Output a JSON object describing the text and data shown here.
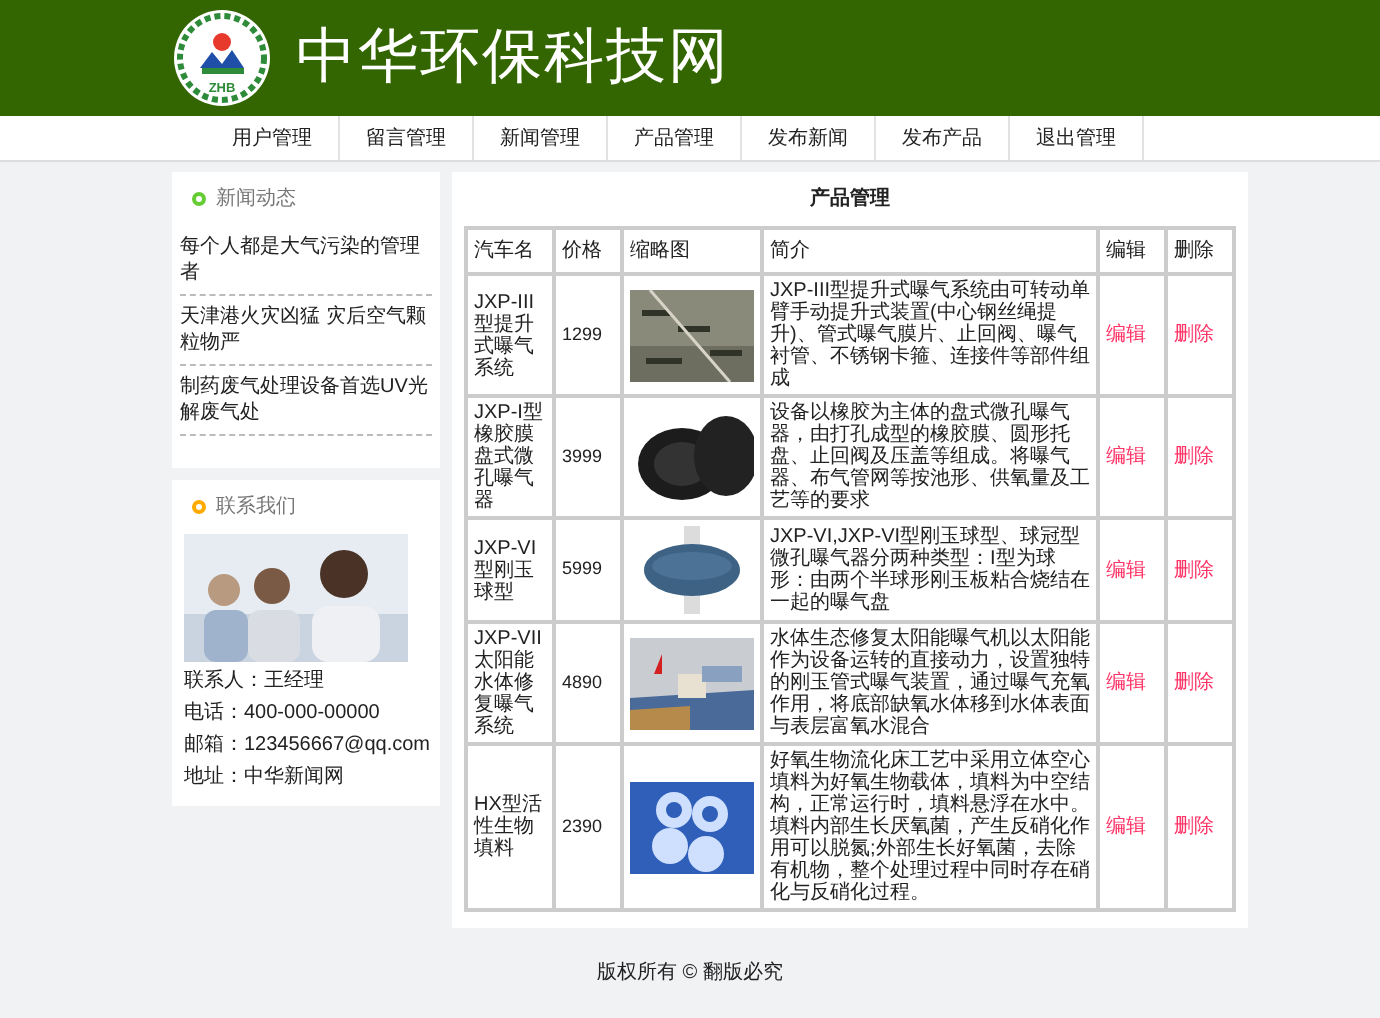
{
  "header": {
    "logo_text": "ZHB",
    "title": "中华环保科技网"
  },
  "nav": [
    "用户管理",
    "留言管理",
    "新闻管理",
    "产品管理",
    "发布新闻",
    "发布产品",
    "退出管理"
  ],
  "news": {
    "title": "新闻动态",
    "color": "#66cc33",
    "items": [
      "每个人都是大气污染的管理者",
      "天津港火灾凶猛 灾后空气颗粒物严",
      "制药废气处理设备首选UV光解废气处"
    ]
  },
  "contact": {
    "title": "联系我们",
    "color": "#ffaa00",
    "lines": [
      "联系人：王经理",
      "电话：400-000-00000",
      "邮箱：123456667@qq.com",
      "地址：中华新闻网"
    ]
  },
  "products": {
    "title": "产品管理",
    "columns": [
      "汽车名",
      "价格",
      "缩略图",
      "简介",
      "编辑",
      "删除"
    ],
    "rows": [
      {
        "name": "JXP-III型提升式曝气系统",
        "price": "1299",
        "intro": "JXP-III型提升式曝气系统由可转动单臂手动提升式装置(中心钢丝绳提升)、管式曝气膜片、止回阀、曝气衬管、不锈钢卡箍、连接件等部件组成",
        "edit": "编辑",
        "delete": "删除"
      },
      {
        "name": "JXP-I型橡胶膜盘式微孔曝气器",
        "price": "3999",
        "intro": "设备以橡胶为主体的盘式微孔曝气器，由打孔成型的橡胶膜、圆形托盘、止回阀及压盖等组成。将曝气器、布气管网等按池形、供氧量及工艺等的要求",
        "edit": "编辑",
        "delete": "删除"
      },
      {
        "name": "JXP-VI型刚玉球型",
        "price": "5999",
        "intro": "JXP-VI,JXP-VI型刚玉球型、球冠型微孔曝气器分两种类型：I型为球形：由两个半球形刚玉板粘合烧结在一起的曝气盘",
        "edit": "编辑",
        "delete": "删除"
      },
      {
        "name": "JXP-VII太阳能水体修复曝气系统",
        "price": "4890",
        "intro": "水体生态修复太阳能曝气机以太阳能作为设备运转的直接动力，设置独特的刚玉管式曝气装置，通过曝气充氧作用，将底部缺氧水体移到水体表面与表层富氧水混合",
        "edit": "编辑",
        "delete": "删除"
      },
      {
        "name": "HX型活性生物填料",
        "price": "2390",
        "intro": "好氧生物流化床工艺中采用立体空心填料为好氧生物载体，填料为中空结构，正常运行时，填料悬浮在水中。填料内部生长厌氧菌，产生反硝化作用可以脱氮;外部生长好氧菌，去除有机物，整个处理过程中同时存在硝化与反硝化过程。",
        "edit": "编辑",
        "delete": "删除"
      }
    ]
  },
  "footer": "版权所有 © 翻版必究"
}
